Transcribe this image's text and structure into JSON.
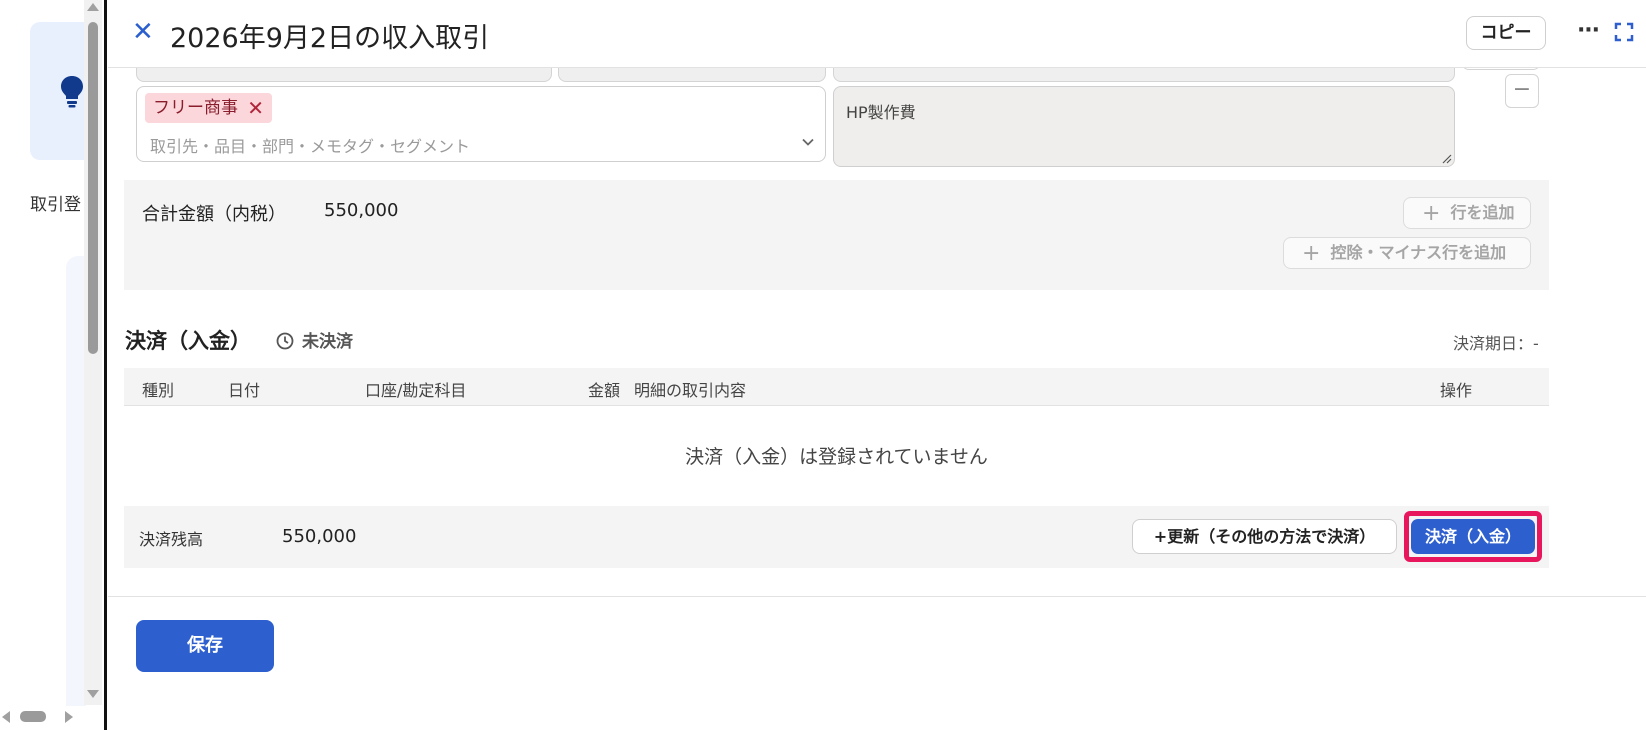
{
  "background": {
    "side_label": "取引登"
  },
  "header": {
    "title": "2026年9月2日の収入取引",
    "copy_label": "コピー",
    "more_label": "···"
  },
  "detail_row": {
    "tag_chip": "フリー商事",
    "tag_placeholder": "取引先・品目・部門・メモタグ・セグメント",
    "note_text": "HP製作費"
  },
  "totals": {
    "label": "合計金額（内税）",
    "value": "550,000",
    "add_row_label": "行を追加",
    "add_minus_row_label": "控除・マイナス行を追加"
  },
  "settlement": {
    "title": "決済（入金）",
    "status": "未決済",
    "due_date_label": "決済期日：-",
    "columns": {
      "type": "種別",
      "date": "日付",
      "account": "口座/勘定科目",
      "amount": "金額",
      "description": "明細の取引内容",
      "actions": "操作"
    },
    "empty_message": "決済（入金）は登録されていません",
    "balance_label": "決済残高",
    "balance_value": "550,000",
    "update_button": "+更新（その他の方法で決済）",
    "settle_button": "決済（入金）"
  },
  "footer": {
    "save_label": "保存"
  },
  "colors": {
    "accent": "#2d5fcf",
    "highlight": "#e8175d",
    "chip_bg": "#fbd7dc"
  }
}
